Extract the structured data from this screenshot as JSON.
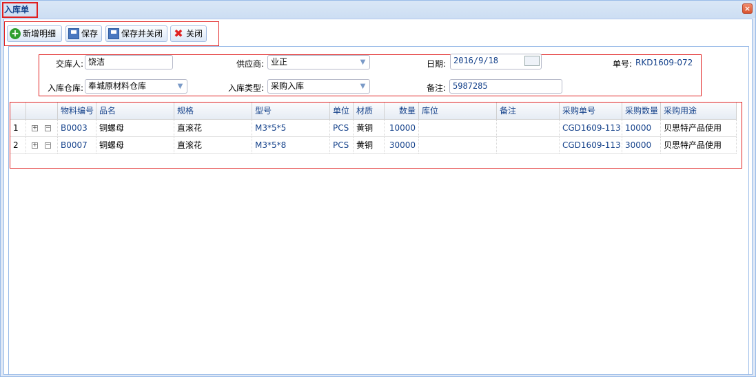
{
  "window": {
    "title": "入库单",
    "close_icon": "close-icon"
  },
  "toolbar": {
    "add_detail_label": "新增明细",
    "save_label": "保存",
    "save_close_label": "保存并关闭",
    "close_label": "关闭"
  },
  "form": {
    "deliverer_label": "交库人:",
    "deliverer_value": "饶洁",
    "supplier_label": "供应商:",
    "supplier_value": "业正",
    "date_label": "日期:",
    "date_value": "2016/9/18",
    "order_no_label": "单号:",
    "order_no_value": "RKD1609-072",
    "warehouse_label": "入库仓库:",
    "warehouse_value": "奉城原材料仓库",
    "inbound_type_label": "入库类型:",
    "inbound_type_value": "采购入库",
    "remark_label": "备注:",
    "remark_value": "5987285"
  },
  "grid": {
    "columns": [
      "物料编号",
      "品名",
      "规格",
      "型号",
      "单位",
      "材质",
      "数量",
      "库位",
      "备注",
      "采购单号",
      "采购数量",
      "采购用途"
    ],
    "rows": [
      {
        "index": "1",
        "expand": "+",
        "collapse": "−",
        "code": "B0003",
        "name": "铜螺母",
        "spec": "直滚花",
        "model": "M3*5*5",
        "unit": "PCS",
        "material": "黄铜",
        "qty": "10000",
        "location": "",
        "remark": "",
        "po_no": "CGD1609-113",
        "po_qty": "10000",
        "purpose": "贝思特产品使用"
      },
      {
        "index": "2",
        "expand": "+",
        "collapse": "−",
        "code": "B0007",
        "name": "铜螺母",
        "spec": "直滚花",
        "model": "M3*5*8",
        "unit": "PCS",
        "material": "黄铜",
        "qty": "30000",
        "location": "",
        "remark": "",
        "po_no": "CGD1609-113",
        "po_qty": "30000",
        "purpose": "贝思特产品使用"
      }
    ]
  }
}
